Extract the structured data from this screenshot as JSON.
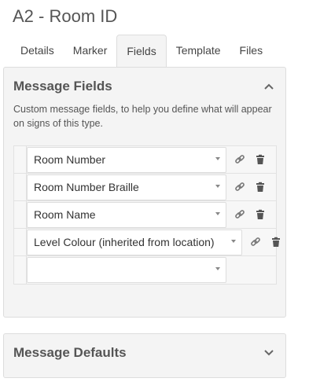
{
  "page": {
    "title": "A2 - Room ID"
  },
  "tabs": [
    {
      "label": "Details"
    },
    {
      "label": "Marker"
    },
    {
      "label": "Fields"
    },
    {
      "label": "Template"
    },
    {
      "label": "Files"
    }
  ],
  "active_tab": "Fields",
  "message_fields": {
    "title": "Message Fields",
    "description": "Custom message fields, to help you define what will appear on signs of this type.",
    "rows": [
      {
        "value": "Room Number"
      },
      {
        "value": "Room Number Braille"
      },
      {
        "value": "Room Name"
      },
      {
        "value": "Level Colour (inherited from location)"
      },
      {
        "value": ""
      }
    ],
    "icons": {
      "link": "link-icon",
      "delete": "trash-icon",
      "collapse": "chevron-up-icon",
      "expand": "chevron-down-icon"
    }
  },
  "message_defaults": {
    "title": "Message Defaults"
  },
  "colors": {
    "panel_bg": "#f4f4f4",
    "border": "#dddddd",
    "text": "#333333"
  }
}
